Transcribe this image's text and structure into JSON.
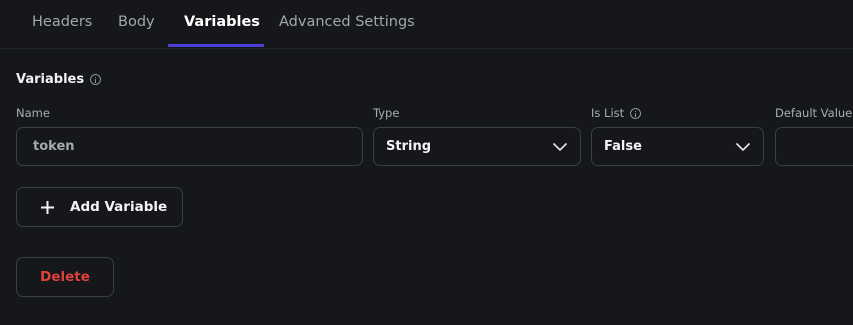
{
  "tabs": [
    {
      "label": "Headers",
      "active": false
    },
    {
      "label": "Body",
      "active": false
    },
    {
      "label": "Variables",
      "active": true
    },
    {
      "label": "Advanced Settings",
      "active": false
    }
  ],
  "section": {
    "title": "Variables",
    "info_icon": "info-icon"
  },
  "columns": {
    "name": "Name",
    "type": "Type",
    "is_list": "Is List",
    "default_value": "Default Value"
  },
  "row": {
    "name_value": "token",
    "type_value": "String",
    "is_list_value": "False",
    "default_value": ""
  },
  "buttons": {
    "add_variable": "Add Variable",
    "delete": "Delete"
  },
  "colors": {
    "background": "#15171a",
    "accent": "#4b3fd9",
    "danger": "#e0423b",
    "border": "#3a3e45"
  }
}
